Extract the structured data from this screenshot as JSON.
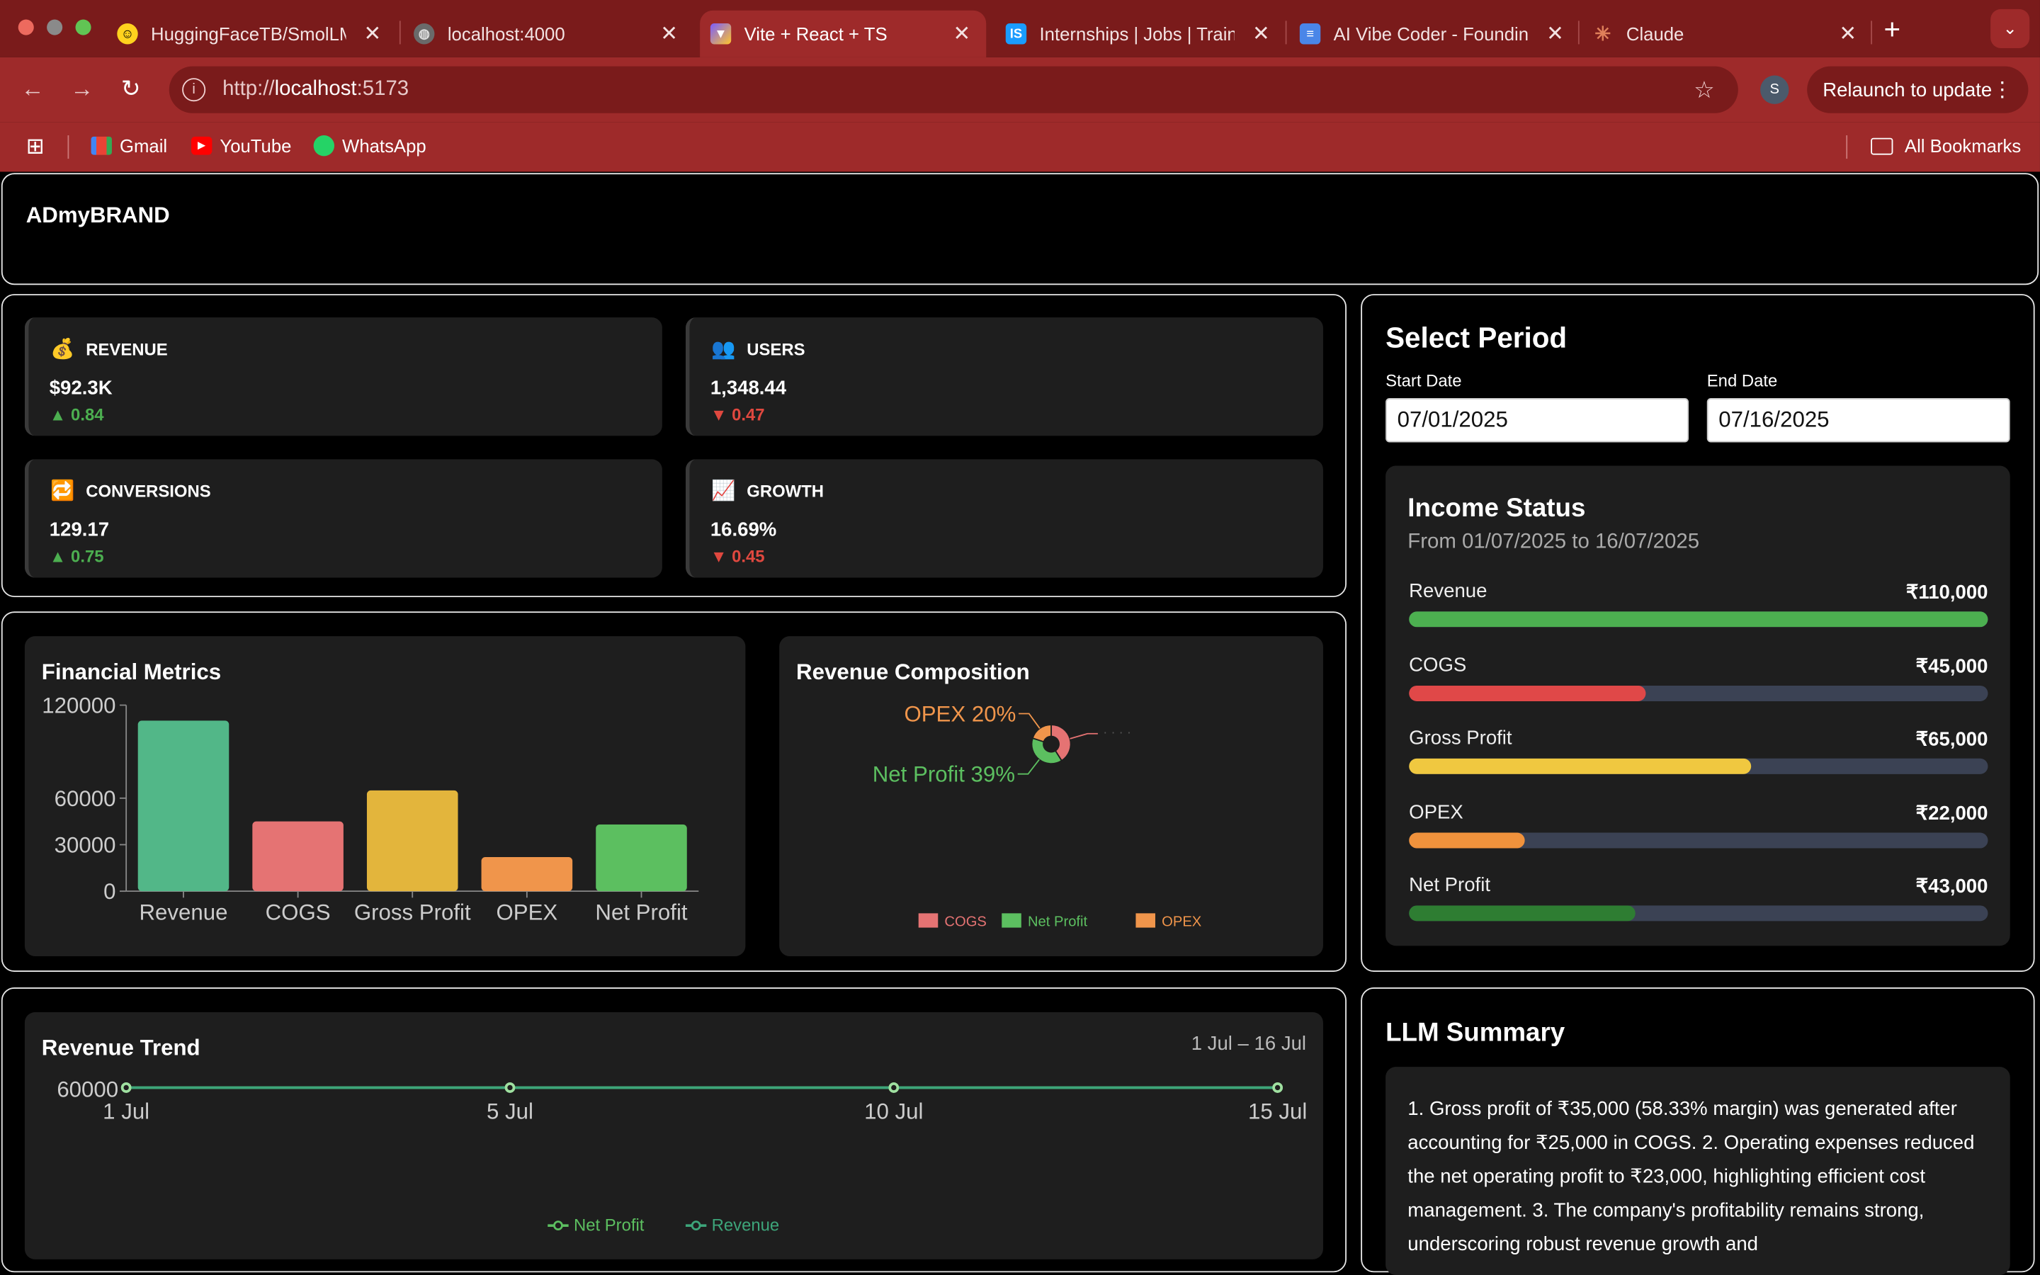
{
  "browser": {
    "tabs": [
      {
        "title": "HuggingFaceTB/SmolLM",
        "icon": "huggingface-icon"
      },
      {
        "title": "localhost:4000",
        "icon": "globe-icon"
      },
      {
        "title": "Vite + React + TS",
        "icon": "vite-icon"
      },
      {
        "title": "Internships | Jobs | Trainings",
        "icon": "internshala-icon"
      },
      {
        "title": "AI Vibe Coder - Founding",
        "icon": "docs-icon"
      },
      {
        "title": "Claude",
        "icon": "claude-icon"
      }
    ],
    "url_scheme": "http://",
    "url_host": "localhost",
    "url_rest": ":5173",
    "profile_initial": "S",
    "relaunch_label": "Relaunch to update",
    "bookmarks": [
      {
        "label": "Gmail",
        "icon": "gmail-icon"
      },
      {
        "label": "YouTube",
        "icon": "youtube-icon"
      },
      {
        "label": "WhatsApp",
        "icon": "whatsapp-icon"
      }
    ],
    "all_bookmarks_label": "All Bookmarks"
  },
  "app": {
    "brand": "ADmyBRAND"
  },
  "kpis": [
    {
      "label": "REVENUE",
      "emoji": "💰",
      "value": "$92.3K",
      "delta": "▲ 0.84",
      "trend": "up"
    },
    {
      "label": "USERS",
      "emoji": "👥",
      "value": "1,348.44",
      "delta": "▼ 0.47",
      "trend": "down"
    },
    {
      "label": "CONVERSIONS",
      "emoji": "🔁",
      "value": "129.17",
      "delta": "▲ 0.75",
      "trend": "up"
    },
    {
      "label": "GROWTH",
      "emoji": "📈",
      "value": "16.69%",
      "delta": "▼ 0.45",
      "trend": "down"
    }
  ],
  "period": {
    "title": "Select Period",
    "start_label": "Start Date",
    "start_value": "07/01/2025",
    "end_label": "End Date",
    "end_value": "07/16/2025"
  },
  "income": {
    "title": "Income Status",
    "subtitle": "From 01/07/2025 to 16/07/2025",
    "items": [
      {
        "label": "Revenue",
        "amount": "₹110,000",
        "fraction": 1.0,
        "color": "#4caf50"
      },
      {
        "label": "COGS",
        "amount": "₹45,000",
        "fraction": 0.41,
        "color": "#e04848"
      },
      {
        "label": "Gross Profit",
        "amount": "₹65,000",
        "fraction": 0.59,
        "color": "#f0c840"
      },
      {
        "label": "OPEX",
        "amount": "₹22,000",
        "fraction": 0.2,
        "color": "#f0923c"
      },
      {
        "label": "Net Profit",
        "amount": "₹43,000",
        "fraction": 0.39,
        "color": "#2e7d32"
      }
    ]
  },
  "llm": {
    "title": "LLM Summary",
    "text": "1. Gross profit of ₹35,000 (58.33% margin) was generated after accounting for ₹25,000 in COGS. 2. Operating expenses reduced the net operating profit to ₹23,000, highlighting efficient cost management. 3. The company's profitability remains strong, underscoring robust revenue growth and"
  },
  "chart_data": [
    {
      "id": "financial-metrics",
      "type": "bar",
      "title": "Financial Metrics",
      "categories": [
        "Revenue",
        "COGS",
        "Gross Profit",
        "OPEX",
        "Net Profit"
      ],
      "values": [
        110000,
        45000,
        65000,
        22000,
        43000
      ],
      "colors": [
        "#52b788",
        "#e57373",
        "#e3b53c",
        "#f0954b",
        "#5cbf60"
      ],
      "yticks": [
        0,
        30000,
        60000,
        120000
      ],
      "ylim": [
        0,
        120000
      ],
      "grid": false
    },
    {
      "id": "revenue-composition",
      "type": "pie",
      "title": "Revenue Composition",
      "labels": [
        "COGS",
        "Net Profit",
        "OPEX"
      ],
      "values": [
        41,
        39,
        20
      ],
      "colors": [
        "#e57373",
        "#5cbf60",
        "#f0954b"
      ],
      "slice_labels": [
        "",
        "Net Profit 39%",
        "OPEX 20%"
      ],
      "legend": "bottom"
    },
    {
      "id": "revenue-trend",
      "type": "line",
      "title": "Revenue Trend",
      "range_label": "1 Jul – 16 Jul",
      "x": [
        "1 Jul",
        "5 Jul",
        "10 Jul",
        "15 Jul"
      ],
      "series": [
        {
          "name": "Net Profit",
          "values": [
            60000,
            60000,
            60000,
            60000
          ],
          "color": "#5cbf60"
        },
        {
          "name": "Revenue",
          "values": [
            60000,
            60000,
            60000,
            60000
          ],
          "color": "#3da57a"
        }
      ],
      "yticks": [
        60000
      ],
      "legend": "bottom"
    }
  ]
}
